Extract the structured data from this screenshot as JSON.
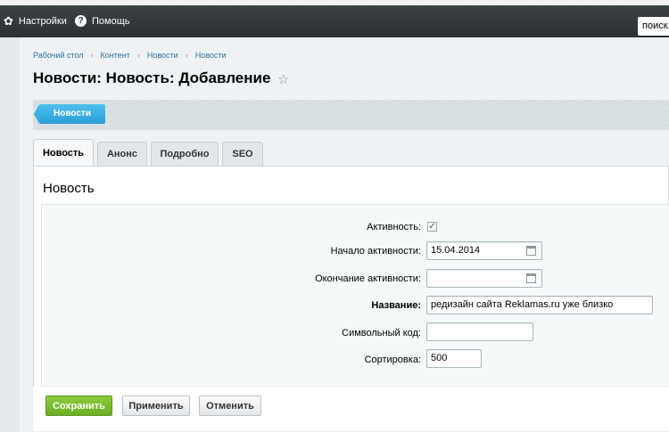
{
  "topbar": {
    "settings": "Настройки",
    "help": "Помощь",
    "search_value": "поиск."
  },
  "breadcrumb": [
    "Рабочий стол",
    "Контент",
    "Новости",
    "Новости"
  ],
  "page_title": "Новости: Новость: Добавление",
  "context_button": "Новости",
  "tabs": [
    "Новость",
    "Анонс",
    "Подробно",
    "SEO"
  ],
  "active_tab": "Новость",
  "section_title": "Новость",
  "fields": {
    "active_label": "Активность:",
    "active_checked": true,
    "start_label": "Начало активности:",
    "start_value": "15.04.2014",
    "end_label": "Окончание активности:",
    "end_value": "",
    "name_label": "Название:",
    "name_value": "редизайн сайта Reklamas.ru уже близко",
    "code_label": "Символьный код:",
    "code_value": "",
    "sort_label": "Сортировка:",
    "sort_value": "500"
  },
  "buttons": {
    "save": "Сохранить",
    "apply": "Применить",
    "cancel": "Отменить"
  },
  "colors": {
    "save_button": "#7cbd2f",
    "context_button": "#35a8e0",
    "topbar": "#33393c"
  }
}
